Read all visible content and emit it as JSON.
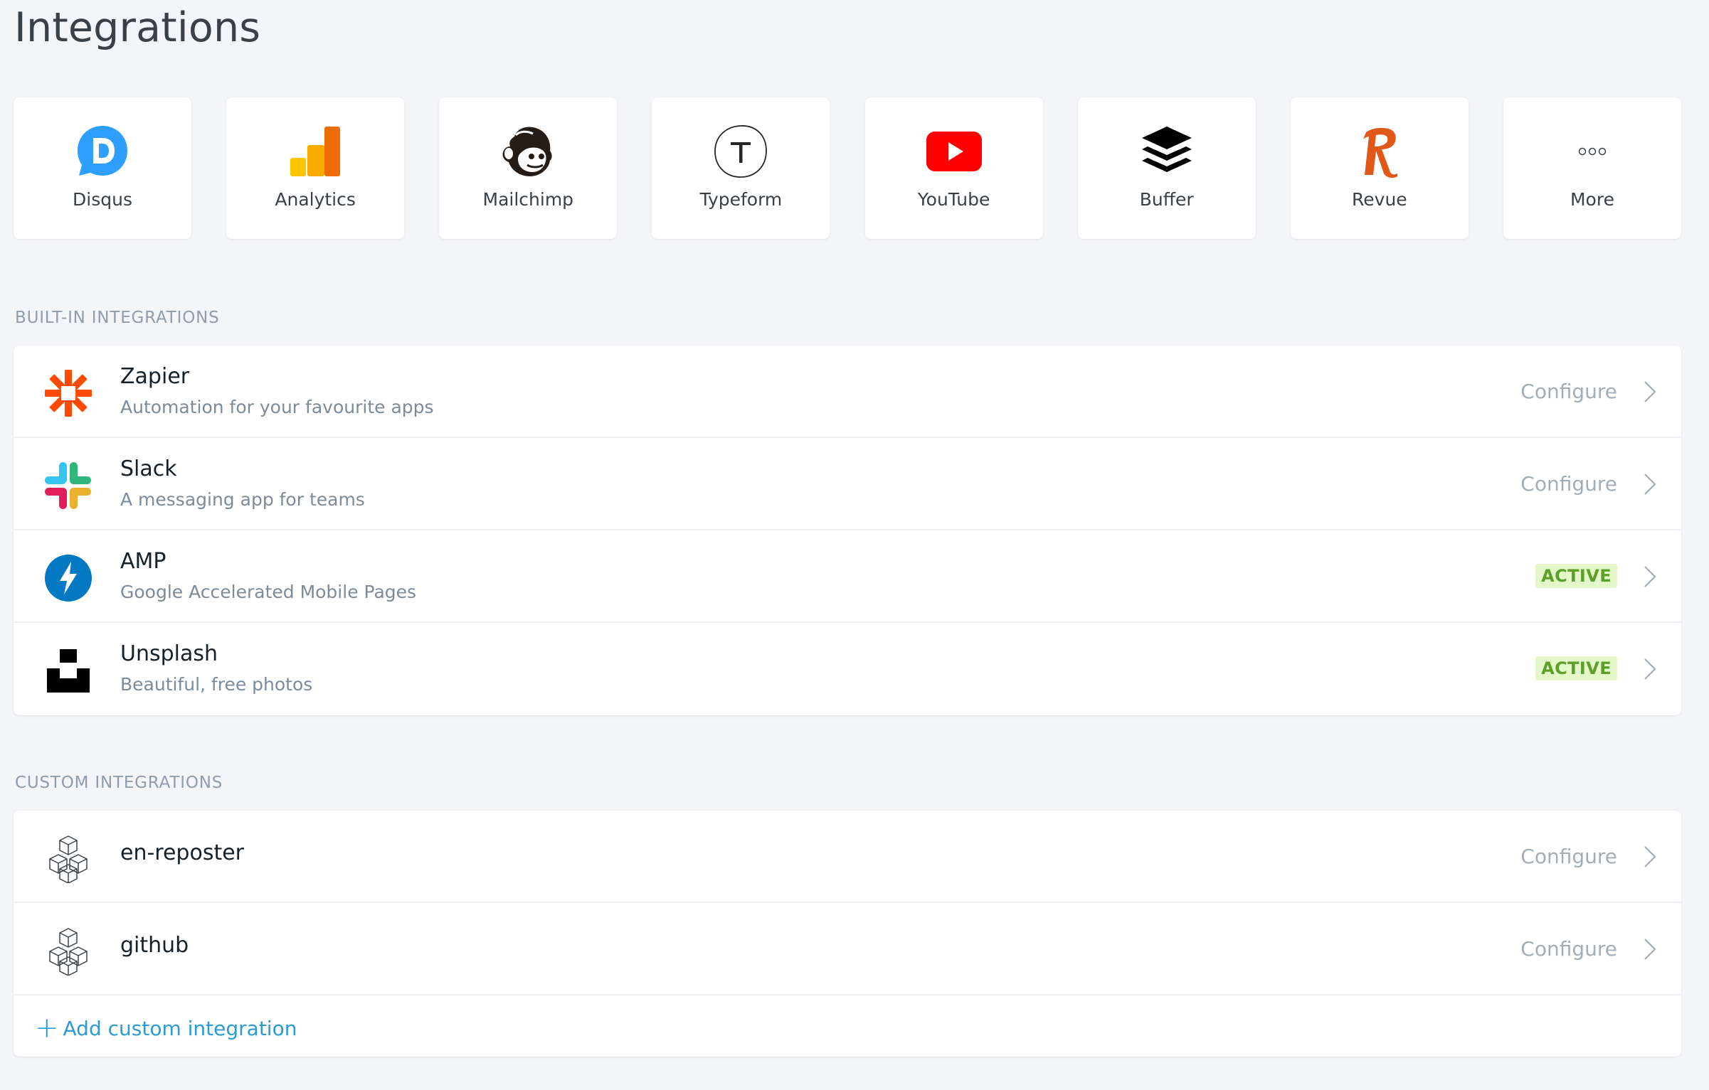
{
  "page": {
    "title": "Integrations"
  },
  "featured": [
    {
      "label": "Disqus",
      "icon": "disqus-logo-icon"
    },
    {
      "label": "Analytics",
      "icon": "google-analytics-logo-icon"
    },
    {
      "label": "Mailchimp",
      "icon": "mailchimp-logo-icon"
    },
    {
      "label": "Typeform",
      "icon": "typeform-logo-icon"
    },
    {
      "label": "YouTube",
      "icon": "youtube-logo-icon"
    },
    {
      "label": "Buffer",
      "icon": "buffer-logo-icon"
    },
    {
      "label": "Revue",
      "icon": "revue-logo-icon"
    },
    {
      "label": "More",
      "icon": "more-dots-icon"
    }
  ],
  "builtin": {
    "heading": "BUILT-IN INTEGRATIONS",
    "items": [
      {
        "name": "Zapier",
        "description": "Automation for your favourite apps",
        "action": "Configure",
        "icon": "zapier-logo-icon"
      },
      {
        "name": "Slack",
        "description": "A messaging app for teams",
        "action": "Configure",
        "icon": "slack-logo-icon"
      },
      {
        "name": "AMP",
        "description": "Google Accelerated Mobile Pages",
        "status": "ACTIVE",
        "icon": "amp-logo-icon"
      },
      {
        "name": "Unsplash",
        "description": "Beautiful, free photos",
        "status": "ACTIVE",
        "icon": "unsplash-logo-icon"
      }
    ]
  },
  "custom": {
    "heading": "CUSTOM INTEGRATIONS",
    "items": [
      {
        "name": "en-reposter",
        "action": "Configure",
        "icon": "cubes-icon"
      },
      {
        "name": "github",
        "action": "Configure",
        "icon": "cubes-icon"
      }
    ],
    "add_label": "Add custom integration"
  },
  "colors": {
    "background": "#f4f5f8",
    "link": "#2c9ad4",
    "badge_bg": "#e4f7c8",
    "badge_text": "#5ca02a",
    "muted": "#a2adb8"
  }
}
